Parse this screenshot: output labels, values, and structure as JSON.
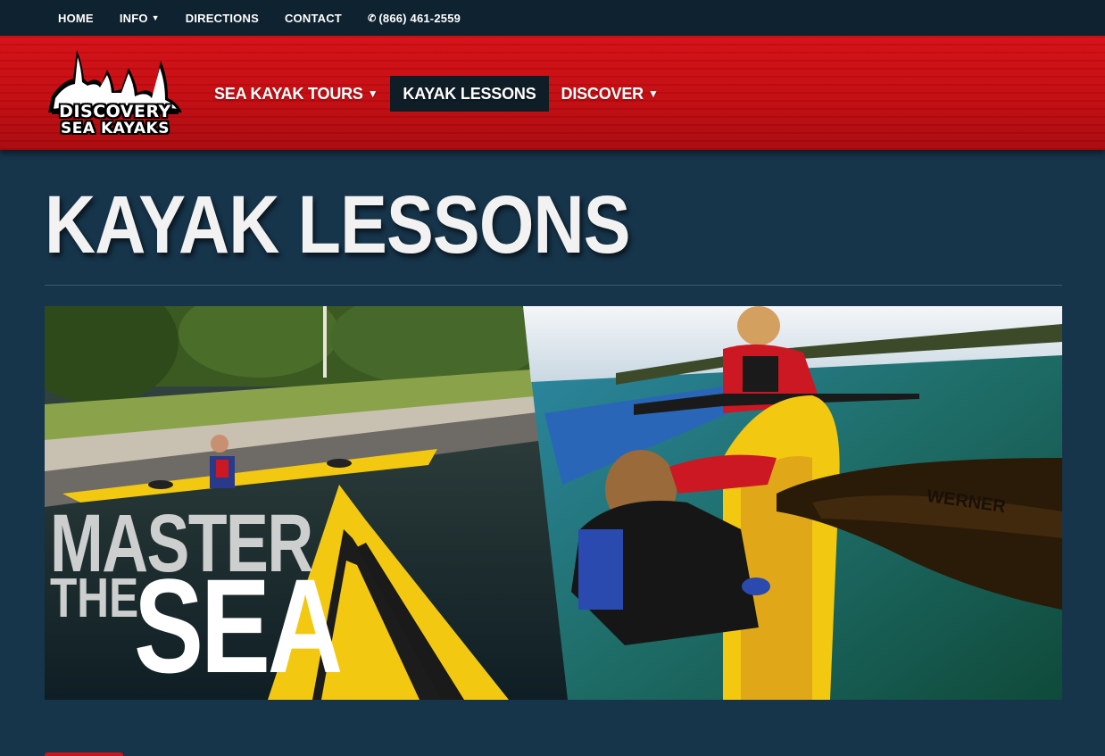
{
  "topbar": {
    "home": "HOME",
    "info": "INFO",
    "directions": "DIRECTIONS",
    "contact": "CONTACT",
    "phone": "(866) 461-2559"
  },
  "logo": {
    "line1": "DISCOVERY",
    "line2": "SEA KAYAKS"
  },
  "mainnav": {
    "tours": "SEA KAYAK TOURS",
    "lessons": "KAYAK LESSONS",
    "discover": "DISCOVER"
  },
  "page": {
    "title": "KAYAK LESSONS"
  },
  "hero": {
    "line1": "MASTER",
    "line2": "THE",
    "line3": "SEA",
    "paddle_brand": "WERNER"
  },
  "icons": {
    "caret": "chevron-down-icon",
    "phone": "phone-icon"
  },
  "colors": {
    "header_red": "#c10b10",
    "topbar_bg": "#0f2230",
    "body_bg": "#16344a",
    "active_nav_bg": "#0f1d26",
    "kayak_yellow": "#f2c811"
  }
}
